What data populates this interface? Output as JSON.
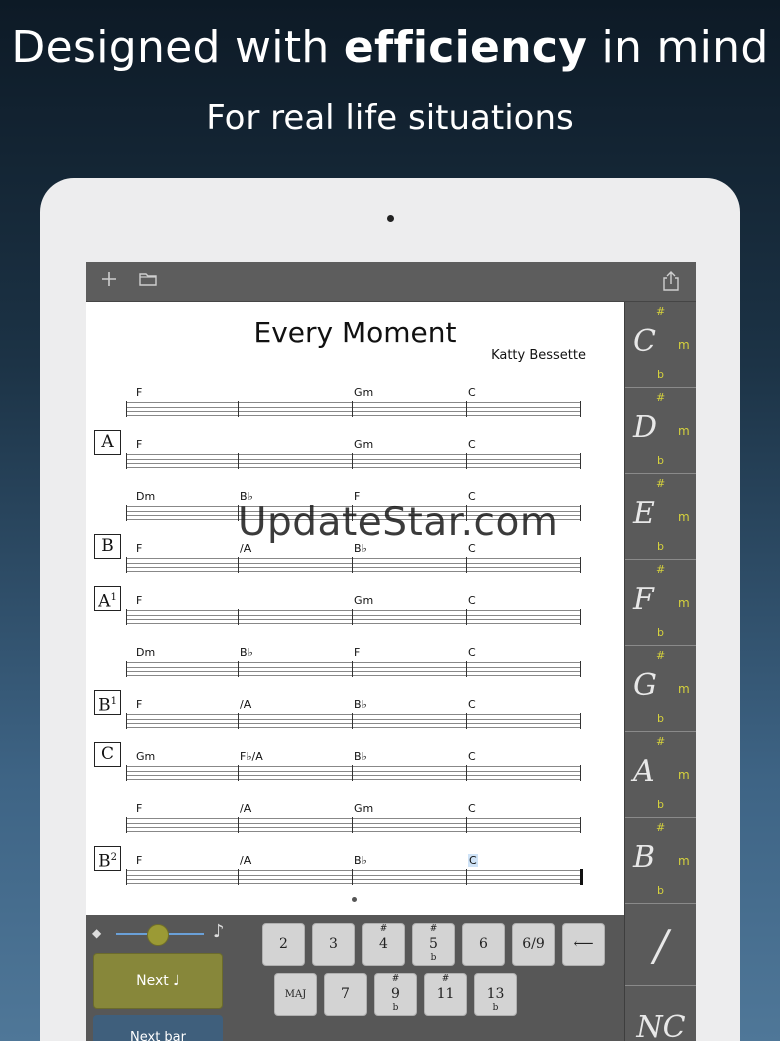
{
  "marketing": {
    "headline_start": "Designed with ",
    "headline_bold": "efficiency",
    "headline_end": " in mind",
    "subhead": "For real life situations"
  },
  "toolbar": {
    "add_icon": "plus-icon",
    "folder_icon": "folder-icon",
    "share_icon": "share-icon"
  },
  "song": {
    "title": "Every Moment",
    "author": "Katty Bessette",
    "rows": [
      {
        "section": "",
        "sup": "",
        "chords": [
          "F",
          "Gm",
          "C"
        ]
      },
      {
        "section": "A",
        "sup": "",
        "chords": [
          "F",
          "Gm",
          "C"
        ]
      },
      {
        "section": "",
        "sup": "",
        "chords": [
          "Dm",
          "B♭",
          "F",
          "C"
        ]
      },
      {
        "section": "B",
        "sup": "",
        "chords": [
          "F",
          "/A",
          "B♭",
          "C"
        ]
      },
      {
        "section": "A",
        "sup": "1",
        "chords": [
          "F",
          "Gm",
          "C"
        ]
      },
      {
        "section": "",
        "sup": "",
        "chords": [
          "Dm",
          "B♭",
          "F",
          "C"
        ]
      },
      {
        "section": "B",
        "sup": "1",
        "chords": [
          "F",
          "/A",
          "B♭",
          "C"
        ]
      },
      {
        "section": "C",
        "sup": "",
        "chords": [
          "Gm",
          "F♭/A",
          "B♭",
          "C"
        ]
      },
      {
        "section": "",
        "sup": "",
        "chords": [
          "F",
          "/A",
          "Gm",
          "C"
        ]
      },
      {
        "section": "B",
        "sup": "2",
        "chords": [
          "F",
          "/A",
          "B♭",
          "C"
        ]
      }
    ]
  },
  "watermark": "UpdateStar.com",
  "keys": {
    "notes": [
      "C",
      "D",
      "E",
      "F",
      "G",
      "A",
      "B"
    ],
    "sharp": "#",
    "flat": "b",
    "minor": "m",
    "slash": "/",
    "nc": "NC"
  },
  "controls": {
    "next_label": "Next",
    "next_bar_label": "Next bar",
    "eraser_icon": "eraser-icon",
    "note_icon": "eighth-note-icon",
    "slider_value": 0.5
  },
  "keypad": {
    "row1": [
      "2",
      "3",
      "4",
      "5",
      "6",
      "6/9"
    ],
    "row2": [
      "MAJ",
      "7",
      "9",
      "11",
      "13"
    ],
    "backspace": "⟵"
  }
}
